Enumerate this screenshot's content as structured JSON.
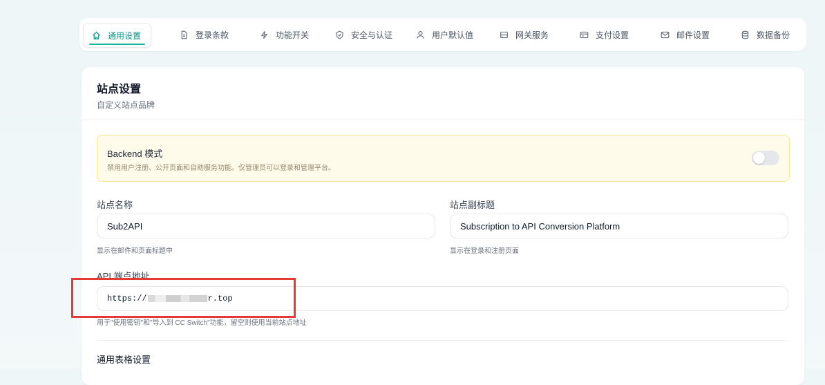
{
  "tabs": [
    {
      "label": "通用设置",
      "icon": "home-icon",
      "active": true
    },
    {
      "label": "登录条款",
      "icon": "document-icon"
    },
    {
      "label": "功能开关",
      "icon": "lightning-icon"
    },
    {
      "label": "安全与认证",
      "icon": "shield-check-icon"
    },
    {
      "label": "用户默认值",
      "icon": "user-icon"
    },
    {
      "label": "网关服务",
      "icon": "server-icon"
    },
    {
      "label": "支付设置",
      "icon": "credit-card-icon"
    },
    {
      "label": "邮件设置",
      "icon": "mail-icon"
    },
    {
      "label": "数据备份",
      "icon": "database-icon"
    }
  ],
  "card": {
    "title": "站点设置",
    "subtitle": "自定义站点品牌"
  },
  "backend": {
    "title": "Backend 模式",
    "description": "禁用用户注册、公开页面和自助服务功能。仅管理员可以登录和管理平台。",
    "enabled": false
  },
  "site_name": {
    "label": "站点名称",
    "value": "Sub2API",
    "help": "显示在邮件和页面标题中"
  },
  "site_subtitle": {
    "label": "站点副标题",
    "value": "Subscription to API Conversion Platform",
    "help": "显示在登录和注册页面"
  },
  "api_endpoint": {
    "label": "API 端点地址",
    "value_prefix": "https://",
    "value_suffix": "r.top",
    "help": "用于\"使用密钥\"和\"导入到 CC Switch\"功能，留空则使用当前站点地址"
  },
  "table_settings": {
    "title": "通用表格设置"
  },
  "colors": {
    "accent": "#14b8a6",
    "highlight_box": "#e53935",
    "warning_bg": "#fffbeb"
  }
}
